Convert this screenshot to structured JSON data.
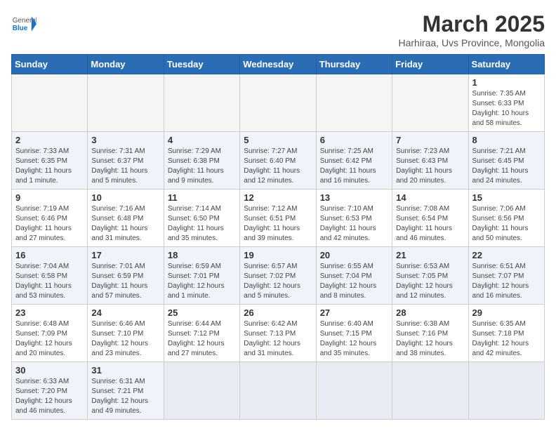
{
  "header": {
    "logo_general": "General",
    "logo_blue": "Blue",
    "month_title": "March 2025",
    "subtitle": "Harhiraa, Uvs Province, Mongolia"
  },
  "days_of_week": [
    "Sunday",
    "Monday",
    "Tuesday",
    "Wednesday",
    "Thursday",
    "Friday",
    "Saturday"
  ],
  "weeks": [
    [
      {
        "day": "",
        "info": ""
      },
      {
        "day": "",
        "info": ""
      },
      {
        "day": "",
        "info": ""
      },
      {
        "day": "",
        "info": ""
      },
      {
        "day": "",
        "info": ""
      },
      {
        "day": "",
        "info": ""
      },
      {
        "day": "1",
        "info": "Sunrise: 7:35 AM\nSunset: 6:33 PM\nDaylight: 10 hours\nand 58 minutes."
      }
    ],
    [
      {
        "day": "2",
        "info": "Sunrise: 7:33 AM\nSunset: 6:35 PM\nDaylight: 11 hours\nand 1 minute."
      },
      {
        "day": "3",
        "info": "Sunrise: 7:31 AM\nSunset: 6:37 PM\nDaylight: 11 hours\nand 5 minutes."
      },
      {
        "day": "4",
        "info": "Sunrise: 7:29 AM\nSunset: 6:38 PM\nDaylight: 11 hours\nand 9 minutes."
      },
      {
        "day": "5",
        "info": "Sunrise: 7:27 AM\nSunset: 6:40 PM\nDaylight: 11 hours\nand 12 minutes."
      },
      {
        "day": "6",
        "info": "Sunrise: 7:25 AM\nSunset: 6:42 PM\nDaylight: 11 hours\nand 16 minutes."
      },
      {
        "day": "7",
        "info": "Sunrise: 7:23 AM\nSunset: 6:43 PM\nDaylight: 11 hours\nand 20 minutes."
      },
      {
        "day": "8",
        "info": "Sunrise: 7:21 AM\nSunset: 6:45 PM\nDaylight: 11 hours\nand 24 minutes."
      }
    ],
    [
      {
        "day": "9",
        "info": "Sunrise: 7:19 AM\nSunset: 6:46 PM\nDaylight: 11 hours\nand 27 minutes."
      },
      {
        "day": "10",
        "info": "Sunrise: 7:16 AM\nSunset: 6:48 PM\nDaylight: 11 hours\nand 31 minutes."
      },
      {
        "day": "11",
        "info": "Sunrise: 7:14 AM\nSunset: 6:50 PM\nDaylight: 11 hours\nand 35 minutes."
      },
      {
        "day": "12",
        "info": "Sunrise: 7:12 AM\nSunset: 6:51 PM\nDaylight: 11 hours\nand 39 minutes."
      },
      {
        "day": "13",
        "info": "Sunrise: 7:10 AM\nSunset: 6:53 PM\nDaylight: 11 hours\nand 42 minutes."
      },
      {
        "day": "14",
        "info": "Sunrise: 7:08 AM\nSunset: 6:54 PM\nDaylight: 11 hours\nand 46 minutes."
      },
      {
        "day": "15",
        "info": "Sunrise: 7:06 AM\nSunset: 6:56 PM\nDaylight: 11 hours\nand 50 minutes."
      }
    ],
    [
      {
        "day": "16",
        "info": "Sunrise: 7:04 AM\nSunset: 6:58 PM\nDaylight: 11 hours\nand 53 minutes."
      },
      {
        "day": "17",
        "info": "Sunrise: 7:01 AM\nSunset: 6:59 PM\nDaylight: 11 hours\nand 57 minutes."
      },
      {
        "day": "18",
        "info": "Sunrise: 6:59 AM\nSunset: 7:01 PM\nDaylight: 12 hours\nand 1 minute."
      },
      {
        "day": "19",
        "info": "Sunrise: 6:57 AM\nSunset: 7:02 PM\nDaylight: 12 hours\nand 5 minutes."
      },
      {
        "day": "20",
        "info": "Sunrise: 6:55 AM\nSunset: 7:04 PM\nDaylight: 12 hours\nand 8 minutes."
      },
      {
        "day": "21",
        "info": "Sunrise: 6:53 AM\nSunset: 7:05 PM\nDaylight: 12 hours\nand 12 minutes."
      },
      {
        "day": "22",
        "info": "Sunrise: 6:51 AM\nSunset: 7:07 PM\nDaylight: 12 hours\nand 16 minutes."
      }
    ],
    [
      {
        "day": "23",
        "info": "Sunrise: 6:48 AM\nSunset: 7:09 PM\nDaylight: 12 hours\nand 20 minutes."
      },
      {
        "day": "24",
        "info": "Sunrise: 6:46 AM\nSunset: 7:10 PM\nDaylight: 12 hours\nand 23 minutes."
      },
      {
        "day": "25",
        "info": "Sunrise: 6:44 AM\nSunset: 7:12 PM\nDaylight: 12 hours\nand 27 minutes."
      },
      {
        "day": "26",
        "info": "Sunrise: 6:42 AM\nSunset: 7:13 PM\nDaylight: 12 hours\nand 31 minutes."
      },
      {
        "day": "27",
        "info": "Sunrise: 6:40 AM\nSunset: 7:15 PM\nDaylight: 12 hours\nand 35 minutes."
      },
      {
        "day": "28",
        "info": "Sunrise: 6:38 AM\nSunset: 7:16 PM\nDaylight: 12 hours\nand 38 minutes."
      },
      {
        "day": "29",
        "info": "Sunrise: 6:35 AM\nSunset: 7:18 PM\nDaylight: 12 hours\nand 42 minutes."
      }
    ],
    [
      {
        "day": "30",
        "info": "Sunrise: 6:33 AM\nSunset: 7:20 PM\nDaylight: 12 hours\nand 46 minutes."
      },
      {
        "day": "31",
        "info": "Sunrise: 6:31 AM\nSunset: 7:21 PM\nDaylight: 12 hours\nand 49 minutes."
      },
      {
        "day": "",
        "info": ""
      },
      {
        "day": "",
        "info": ""
      },
      {
        "day": "",
        "info": ""
      },
      {
        "day": "",
        "info": ""
      },
      {
        "day": "",
        "info": ""
      }
    ]
  ]
}
